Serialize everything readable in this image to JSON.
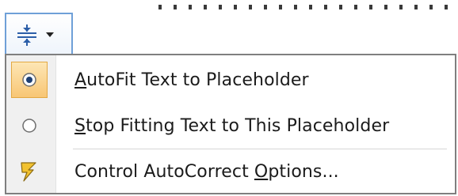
{
  "placeholder": {
    "border_style": "dashed"
  },
  "autofit_button": {
    "icon": "autofit-options-icon",
    "dropdown_icon": "dropdown-arrow-icon"
  },
  "menu": {
    "items": [
      {
        "label": "AutoFit Text to Placeholder",
        "access_key": "A",
        "icon": "radio-selected-icon",
        "checked": true
      },
      {
        "label": "Stop Fitting Text to This Placeholder",
        "access_key": "S",
        "icon": "radio-empty-icon",
        "checked": false
      },
      {
        "label": "Control AutoCorrect Options...",
        "access_key": "O",
        "icon": "autocorrect-lightning-icon",
        "checked": false
      }
    ]
  },
  "colors": {
    "button_border": "#6fa0d8",
    "checked_highlight": "#f8c675",
    "autocorrect_icon": "#f2c230"
  }
}
